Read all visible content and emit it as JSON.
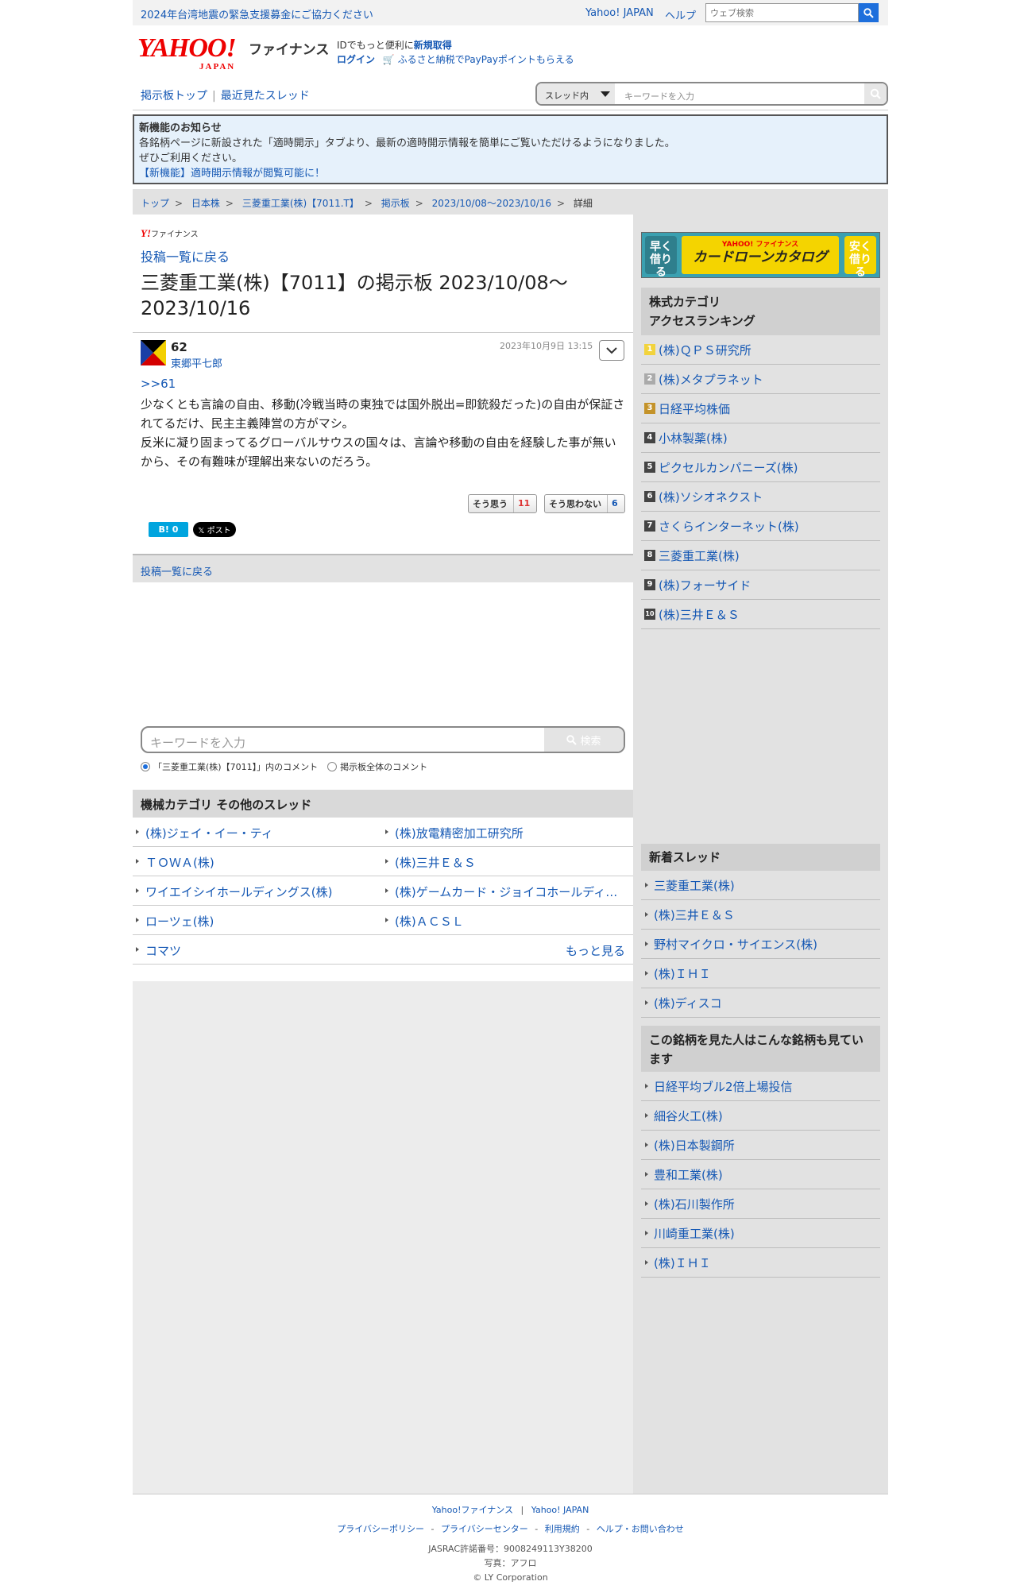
{
  "topbar": {
    "notice": "2024年台湾地震の緊急支援募金にご協力ください",
    "yahoo_japan": "Yahoo! JAPAN",
    "help": "ヘルプ",
    "search_placeholder": "ウェブ検索"
  },
  "logo": {
    "main": "YAHOO!",
    "sub": "JAPAN",
    "service": "ファイナンス"
  },
  "idline": {
    "text1": "IDでもっと便利に",
    "signup": "新規取得",
    "login": "ログイン",
    "furusato": "ふるさと納税でPayPayポイントもらえる"
  },
  "boardnav": {
    "top": "掲示板トップ",
    "recent": "最近見たスレッド",
    "sep": "|"
  },
  "threadsearch": {
    "scope": "スレッド内",
    "placeholder": "キーワードを入力"
  },
  "news": {
    "title": "新機能のお知らせ",
    "line1": "各銘柄ページに新設された「適時開示」タブより、最新の適時開示情報を簡単にご覧いただけるようになりました。",
    "line2": "ぜひご利用ください。",
    "link": "【新機能】適時開示情報が閲覧可能に！"
  },
  "breadcrumb": {
    "items": [
      "トップ",
      "日本株",
      "三菱重工業(株)【7011.T】",
      "掲示板",
      "2023/10/08〜2023/10/16"
    ],
    "current": "詳細",
    "sep": ">"
  },
  "brand": {
    "y": "Y!",
    "text": "ファイナンス"
  },
  "back_link": "投稿一覧に戻る",
  "thread_title": "三菱重工業(株)【7011】の掲示板 2023/10/08〜2023/10/16",
  "post": {
    "number": "62",
    "user": "東郷平七郎",
    "date": "2023年10月9日 13:15",
    "reply": ">>61",
    "lines": [
      "少なくとも言論の自由、移動(冷戦当時の東独では国外脱出=即銃殺だった)の自由が保証されてるだけ、民主主義陣営の方がマシ。",
      "反米に凝り固まってるグローバルサウスの国々は、言論や移動の自由を経験した事が無いから、その有難味が理解出来ないのだろう。"
    ],
    "agree_label": "そう思う",
    "agree_count": "11",
    "disagree_label": "そう思わない",
    "disagree_count": "6"
  },
  "share": {
    "hatena": "B! 0",
    "x": "𝕏 ポスト"
  },
  "back_bar": "投稿一覧に戻る",
  "kwsearch": {
    "placeholder": "キーワードを入力",
    "button": "検索",
    "opt1": "「三菱重工業(株)【7011】」内のコメント",
    "opt2": "掲示板全体のコメント"
  },
  "other_threads": {
    "title": "機械カテゴリ その他のスレッド",
    "items": [
      "(株)ジェイ・イー・ティ",
      "(株)放電精密加工研究所",
      "ＴＯＷＡ(株)",
      "(株)三井Ｅ＆Ｓ",
      "ワイエイシイホールディングス(株)",
      "(株)ゲームカード・ジョイコホールディングス",
      "ローツェ(株)",
      "(株)ＡＣＳＬ",
      "コマツ"
    ],
    "more": "もっと見る"
  },
  "side_banner": {
    "left": "早く借りる",
    "right": "安く借りる",
    "top": "YAHOO! ファイナンス",
    "main": "カードローンカタログ"
  },
  "ranking": {
    "title1": "株式カテゴリ",
    "title2": "アクセスランキング",
    "items": [
      {
        "rank": "1",
        "name": "(株)ＱＰＳ研究所",
        "color": "#f2d33c"
      },
      {
        "rank": "2",
        "name": "(株)メタプラネット",
        "color": "#aaaaaa"
      },
      {
        "rank": "3",
        "name": "日経平均株価",
        "color": "#c4932a"
      },
      {
        "rank": "4",
        "name": "小林製薬(株)",
        "color": "#444444"
      },
      {
        "rank": "5",
        "name": "ピクセルカンパニーズ(株)",
        "color": "#444444"
      },
      {
        "rank": "6",
        "name": "(株)ソシオネクスト",
        "color": "#444444"
      },
      {
        "rank": "7",
        "name": "さくらインターネット(株)",
        "color": "#444444"
      },
      {
        "rank": "8",
        "name": "三菱重工業(株)",
        "color": "#444444"
      },
      {
        "rank": "9",
        "name": "(株)フォーサイド",
        "color": "#444444"
      },
      {
        "rank": "10",
        "name": "(株)三井Ｅ＆Ｓ",
        "color": "#444444"
      }
    ]
  },
  "new_threads": {
    "title": "新着スレッド",
    "items": [
      "三菱重工業(株)",
      "(株)三井Ｅ＆Ｓ",
      "野村マイクロ・サイエンス(株)",
      "(株)ＩＨＩ",
      "(株)ディスコ"
    ]
  },
  "also_viewed": {
    "title": "この銘柄を見た人はこんな銘柄も見ています",
    "items": [
      "日経平均ブル2倍上場投信",
      "細谷火工(株)",
      "(株)日本製鋼所",
      "豊和工業(株)",
      "(株)石川製作所",
      "川崎重工業(株)",
      "(株)ＩＨＩ"
    ]
  },
  "footer": {
    "finance": "Yahoo!ファイナンス",
    "yj": "Yahoo! JAPAN",
    "sep1": "|",
    "privacy": "プライバシーポリシー",
    "privacy_center": "プライバシーセンター",
    "terms": "利用規約",
    "help": "ヘルプ・お問い合わせ",
    "dash": "-",
    "jasrac": "JASRAC許諾番号：9008249113Y38200",
    "photo": "写真：アフロ",
    "copy": "© LY Corporation"
  },
  "colors": {
    "link": "#1558b4",
    "accent": "#1e6fdc",
    "brand_red": "#ee0000"
  }
}
